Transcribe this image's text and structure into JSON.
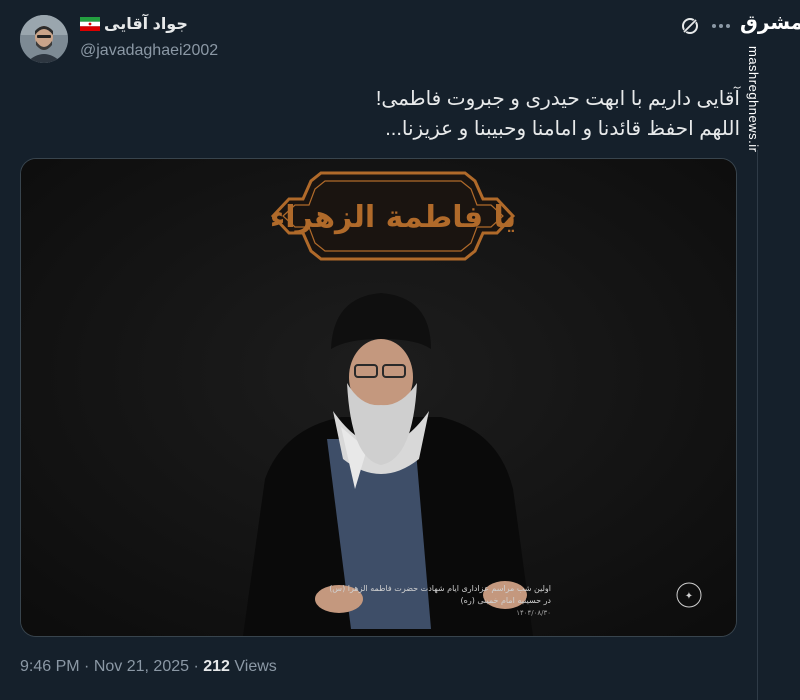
{
  "author": {
    "display_name": "جواد آقایی",
    "handle": "@javadaghaei2002",
    "flag": "iran-flag-icon"
  },
  "watermark": {
    "logo_text": "مشرق",
    "domain": "mashreghnews.ir"
  },
  "tweet": {
    "line1": "آقایی داریم با ابهت حیدری و جبروت فاطمی!",
    "line2": "اللهم احفظ قائدنا و امامنا وحبیبنا و عزیزنا..."
  },
  "media": {
    "banner_text": "یا فاطمة الزهراء",
    "caption_line1": "اولین شب مراسم عزاداری ایام شهادت حضرت فاطمه الزهرا (س)",
    "caption_line2": "در حسینیه امام خمینی (ره)",
    "caption_date": "۱۴۰۴/۰۸/۳۰",
    "colors": {
      "banner": "#b06a2a",
      "background": "#141414"
    }
  },
  "meta": {
    "time": "9:46 PM",
    "separator": "·",
    "date": "Nov 21, 2025",
    "views_count": "212",
    "views_label": "Views"
  }
}
